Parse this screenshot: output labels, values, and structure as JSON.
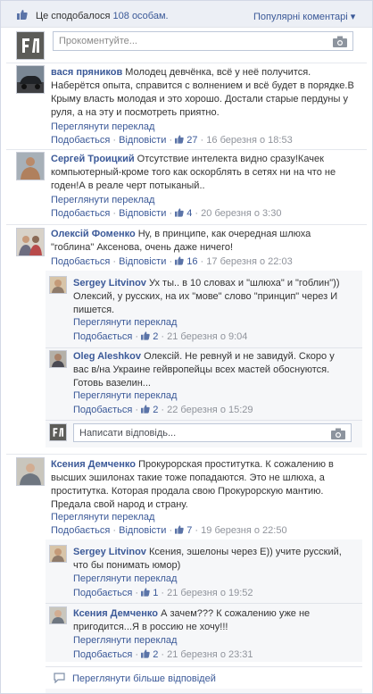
{
  "header": {
    "likes_prefix": "Це сподобалося",
    "likes_count": "108 особам.",
    "sort_label": "Популярні коментарі ▾"
  },
  "composer": {
    "placeholder": "Прокоментуйте..."
  },
  "common": {
    "translate": "Переглянути переклад",
    "like": "Подобається",
    "reply": "Відповісти",
    "dot": "·"
  },
  "comments": [
    {
      "author": "вася пряников",
      "text": "Молодец девчёнка, всё у неё получится. Наберётся опыта, справится с волнением и всё будет в порядке.В Крыму власть молодая и это хорошо. Достали старые пердуны у руля, а на эту и посмотреть приятно.",
      "likes": "27",
      "date": "16 березня о 18:53"
    },
    {
      "author": "Сергей Троицкий",
      "text": "Отсутствие интелекта видно сразу!Качек компьютерный-кроме того как оскорблять в сетях ни на что не годен!А в реале черт потыканый..",
      "likes": "4",
      "date": "20 березня о 3:30"
    },
    {
      "author": "Олексій Фоменко",
      "text": "Ну, в принципе, как очередная шлюха \"гоблина\" Аксенова, очень даже ничего!",
      "likes": "16",
      "date": "17 березня о 22:03",
      "replies": [
        {
          "author": "Sergey Litvinov",
          "text": "Ух ты.. в 10 словах и \"шлюха\" и \"гоблин\")) Олексий, у русских, на их \"мове\" слово \"принцип\" через И пишется.",
          "likes": "2",
          "date": "21 березня о 9:04"
        },
        {
          "author": "Oleg Aleshkov",
          "text": "Олексій. Не ревнуй и не завидуй. Скоро у вас в/на Украине гейвропейцы всех мастей обоснуются. Готовь вазелин...",
          "likes": "2",
          "date": "22 березня о 15:29"
        }
      ],
      "reply_placeholder": "Написати відповідь..."
    },
    {
      "author": "Ксения Демченко",
      "text": "Прокурорская проститутка. К сожалению в высших эшилонах такие тоже попадаются. Это не шлюха, а проститутка. Которая продала свою Прокурорскую мантию. Предала свой народ и страну.",
      "likes": "7",
      "date": "19 березня о 22:50",
      "replies": [
        {
          "author": "Sergey Litvinov",
          "text": "Ксения, эшелоны через Е)) учите русский, что бы понимать юмор)",
          "likes": "1",
          "date": "21 березня о 19:52"
        },
        {
          "author": "Ксения Демченко",
          "text": "А зачем??? К сожалению уже не пригодится...Я в россию не хочу!!!",
          "likes": "2",
          "date": "21 березня о 23:31"
        }
      ],
      "more_replies": "Переглянути більше відповідей"
    }
  ]
}
